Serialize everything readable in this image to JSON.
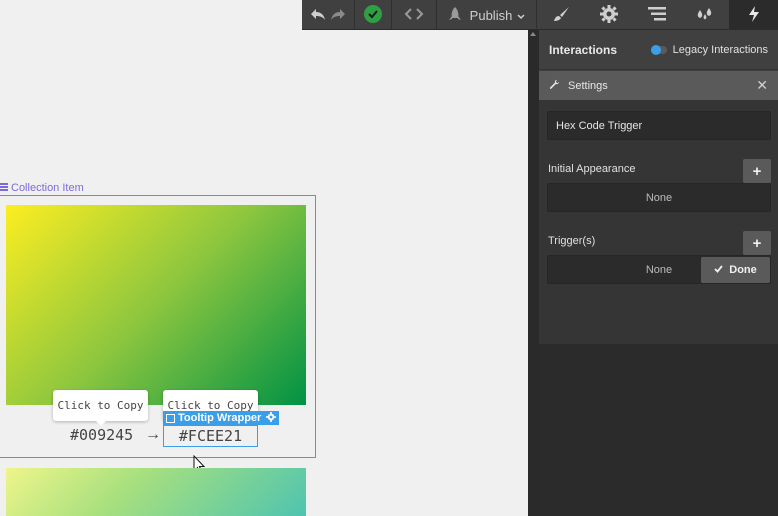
{
  "toolbar": {
    "publish_label": "Publish",
    "icons": [
      "undo-icon",
      "redo-icon",
      "check-circle-icon",
      "code-icon",
      "rocket-icon",
      "brush-icon",
      "gear-icon",
      "navigator-icon",
      "drops-icon",
      "lightning-icon"
    ],
    "accent_green": "#2ea043"
  },
  "canvas": {
    "collection_item_label": "Collection Item",
    "tooltip_left": "Click to Copy",
    "tooltip_right": "Click to Copy",
    "hex_left": "#009245",
    "hex_right": "#FCEE21",
    "tooltip_wrapper_label": "Tooltip Wrapper",
    "selection_color": "#3b9ee8",
    "collection_color": "#8a7bd9"
  },
  "panel": {
    "title": "Interactions",
    "legacy_label": "Legacy Interactions",
    "settings_title": "Settings",
    "trigger_name": "Hex Code Trigger",
    "initial_appearance_label": "Initial Appearance",
    "initial_appearance_value": "None",
    "triggers_label": "Trigger(s)",
    "triggers_value": "None",
    "done_label": "Done"
  }
}
